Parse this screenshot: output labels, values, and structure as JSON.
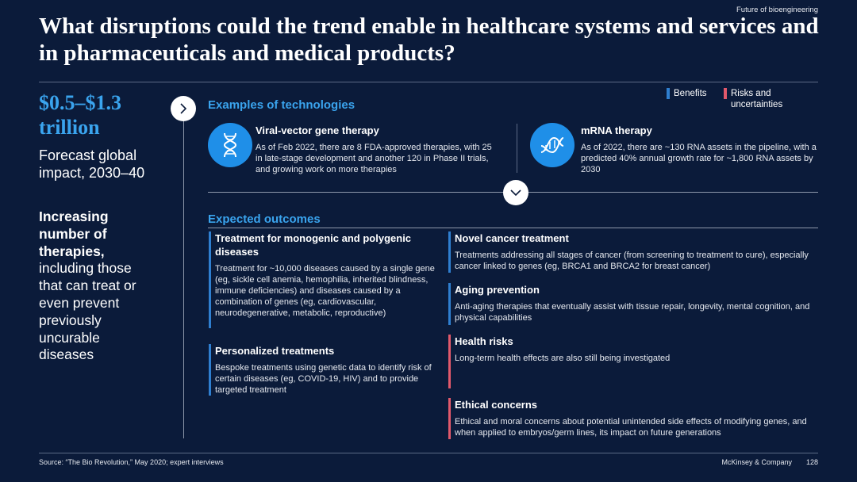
{
  "header": {
    "tag": "Future of bioengineering",
    "title": "What disruptions could the trend enable in healthcare systems and services and in pharmaceuticals and medical products?"
  },
  "left": {
    "impact_value": "$0.5–$1.3 trillion",
    "impact_label": "Forecast global impact, 2030–40",
    "therapies_bold": "Increasing number of therapies,",
    "therapies_rest": " including those that can treat or even prevent previously uncurable diseases"
  },
  "legend": {
    "benefits": "Benefits",
    "risks": "Risks and uncertainties"
  },
  "colors": {
    "background": "#0b1b3a",
    "accent": "#3aa4ee",
    "icon_fill": "#1f8fe8",
    "benefit_bar": "#2f7fd0",
    "risk_bar": "#e2596b"
  },
  "technologies": {
    "heading": "Examples of technologies",
    "items": [
      {
        "icon": "dna-helix-icon",
        "title": "Viral-vector gene therapy",
        "text": "As of Feb 2022, there are 8 FDA-approved therapies, with 25 in late-stage development and another 120 in Phase II trials, and growing work on more therapies"
      },
      {
        "icon": "mrna-strand-icon",
        "title": "mRNA therapy",
        "text": "As of 2022, there are ~130 RNA assets in the pipeline, with a predicted 40% annual growth rate for ~1,800 RNA assets by 2030"
      }
    ]
  },
  "outcomes": {
    "heading": "Expected outcomes",
    "items": [
      {
        "kind": "benefit",
        "title": "Treatment for monogenic and polygenic diseases",
        "text": "Treatment for ~10,000 diseases caused by a single gene (eg, sickle cell anemia, hemophilia, inherited blindness, immune deficiencies) and diseases caused by a combination of genes (eg, cardiovascular, neurodegenerative, metabolic, reproductive)"
      },
      {
        "kind": "benefit",
        "title": "Personalized treatments",
        "text": "Bespoke treatments using genetic data to identify risk of certain diseases (eg, COVID-19, HIV) and to provide targeted treatment"
      },
      {
        "kind": "benefit",
        "title": "Novel cancer treatment",
        "text": "Treatments addressing all stages of cancer (from screening to treatment to cure), especially cancer linked to genes (eg, BRCA1 and BRCA2 for breast cancer)"
      },
      {
        "kind": "benefit",
        "title": "Aging prevention",
        "text": "Anti-aging therapies that eventually assist with tissue repair, longevity, mental cognition, and physical capabilities"
      },
      {
        "kind": "risk",
        "title": "Health risks",
        "text": "Long-term health effects are also still being investigated"
      },
      {
        "kind": "risk",
        "title": "Ethical concerns",
        "text": "Ethical and moral concerns about potential unintended side effects of modifying genes, and when applied to embryos/germ lines, its impact on future generations"
      }
    ]
  },
  "footer": {
    "source": "Source: “The Bio Revolution,” May 2020; expert interviews",
    "brand": "McKinsey & Company",
    "page": "128"
  }
}
